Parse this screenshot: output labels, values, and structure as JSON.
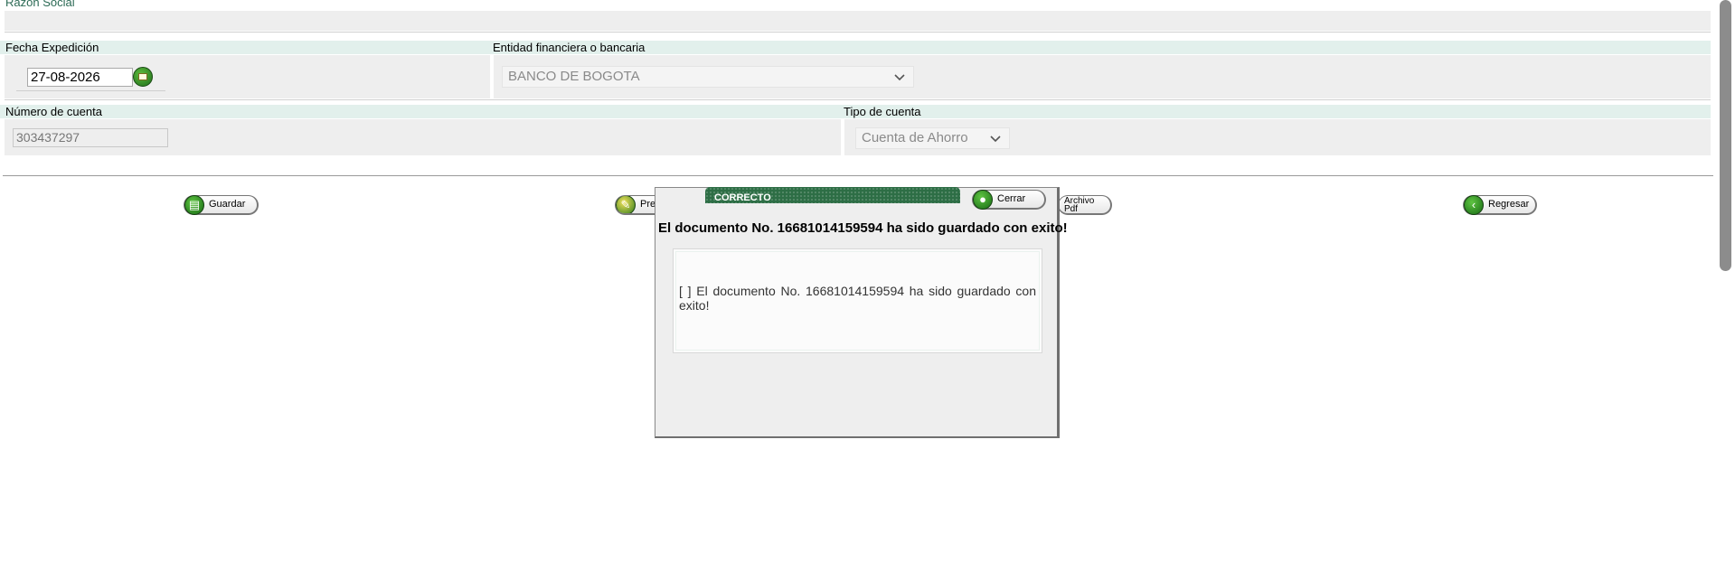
{
  "form": {
    "razon_social_label": "Razón Social",
    "fecha_expedicion_label": "Fecha Expedición",
    "fecha_expedicion_value": "27-08-2026",
    "entidad_label": "Entidad financiera o bancaria",
    "entidad_value": "BANCO DE BOGOTA",
    "numero_cuenta_label": "Número de cuenta",
    "numero_cuenta_value": "303437297",
    "tipo_cuenta_label": "Tipo de cuenta",
    "tipo_cuenta_value": "Cuenta de Ahorro"
  },
  "toolbar": {
    "guardar_label": "Guardar",
    "presentar_label": "Presentar",
    "archivo_pdf_label_1": "Archivo",
    "archivo_pdf_label_2": "Pdf",
    "regresar_label": "Regresar"
  },
  "dialog": {
    "title": "CORRECTO",
    "close_label": "Cerrar",
    "message": "El documento No. 16681014159594 ha sido guardado con exito!",
    "detail": "[ ] El documento No. 16681014159594 ha sido guardado con exito!"
  },
  "colors": {
    "label_bar": "#e2f0ec",
    "field_bg": "#eeeeee",
    "dialog_header": "#2d6e45",
    "icon_green": "#2c8a22"
  },
  "icons": {
    "calendar": "calendar-icon",
    "guardar": "save-icon",
    "presentar": "present-icon",
    "cerrar": "close-icon",
    "regresar": "back-arrow-icon",
    "dropdown": "chevron-down-icon"
  }
}
